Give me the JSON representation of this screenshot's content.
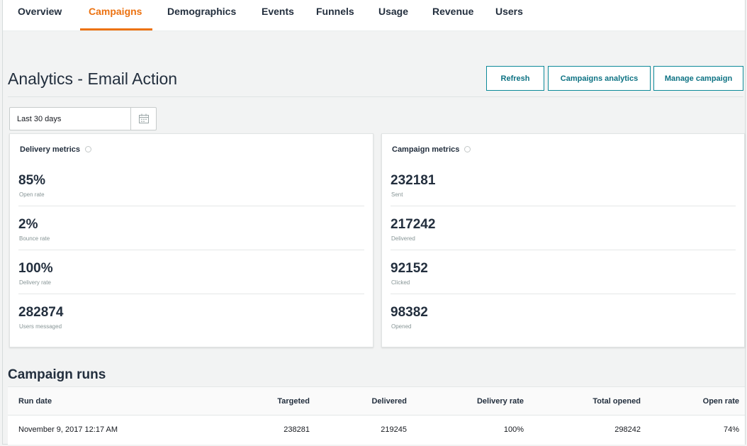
{
  "tabs": [
    {
      "label": "Overview",
      "active": false
    },
    {
      "label": "Campaigns",
      "active": true
    },
    {
      "label": "Demographics",
      "active": false
    },
    {
      "label": "Events",
      "active": false
    },
    {
      "label": "Funnels",
      "active": false
    },
    {
      "label": "Usage",
      "active": false
    },
    {
      "label": "Revenue",
      "active": false
    },
    {
      "label": "Users",
      "active": false
    }
  ],
  "header": {
    "title": "Analytics - Email Action",
    "buttons": {
      "refresh": "Refresh",
      "campaigns_analytics": "Campaigns analytics",
      "manage_campaign": "Manage campaign"
    }
  },
  "date_range": {
    "value": "Last 30 days",
    "icon": "calendar-icon"
  },
  "delivery_metrics": {
    "title": "Delivery metrics",
    "items": [
      {
        "value": "85%",
        "label": "Open rate"
      },
      {
        "value": "2%",
        "label": "Bounce rate"
      },
      {
        "value": "100%",
        "label": "Delivery rate"
      },
      {
        "value": "282874",
        "label": "Users messaged"
      }
    ]
  },
  "campaign_metrics": {
    "title": "Campaign metrics",
    "items": [
      {
        "value": "232181",
        "label": "Sent"
      },
      {
        "value": "217242",
        "label": "Delivered"
      },
      {
        "value": "92152",
        "label": "Clicked"
      },
      {
        "value": "98382",
        "label": "Opened"
      }
    ]
  },
  "campaign_runs": {
    "title": "Campaign runs",
    "columns": [
      "Run date",
      "Targeted",
      "Delivered",
      "Delivery rate",
      "Total opened",
      "Open rate"
    ],
    "rows": [
      [
        "November 9, 2017 12:17 AM",
        "238281",
        "219245",
        "100%",
        "298242",
        "74%"
      ]
    ]
  },
  "colors": {
    "accent": "#ec7211",
    "button_border": "#0d8a99",
    "text": "#232f3e"
  }
}
